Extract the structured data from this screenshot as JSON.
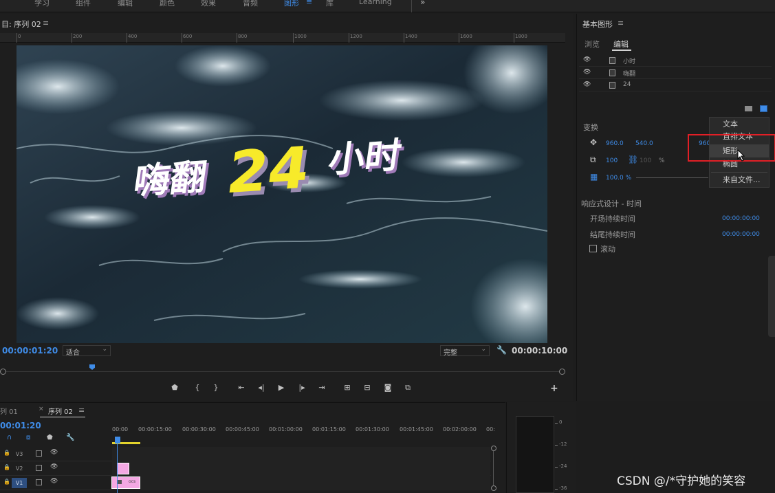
{
  "workspaces": {
    "items": [
      "学习",
      "组件",
      "编辑",
      "颜色",
      "效果",
      "音频",
      "图形",
      "库",
      "Learning"
    ],
    "active": "图形",
    "more_icon": "double-chevron-right",
    "menu_icon": "hamburger"
  },
  "program_monitor": {
    "tab_title": "目: 序列 02",
    "ruler_ticks": [
      "0",
      "200",
      "400",
      "600",
      "800",
      "1000",
      "1200",
      "1400",
      "1600",
      "1800"
    ],
    "title_text": {
      "part1": "嗨翻",
      "number": "24",
      "part2": "小时"
    },
    "timecode_current": "00:00:01:20",
    "fit_select": "适合",
    "quality_select": "完整",
    "timecode_duration": "00:00:10:00",
    "transport_buttons": [
      "marker",
      "mark-in",
      "mark-out",
      "go-to-in",
      "step-back",
      "play",
      "step-forward",
      "go-to-out",
      "insert",
      "overwrite",
      "export-frame",
      "compare"
    ],
    "add_button": "+"
  },
  "essential_graphics": {
    "title": "基本图形",
    "tabs": [
      "浏览",
      "编辑"
    ],
    "active_tab": "编辑",
    "layers": [
      {
        "name": "小时"
      },
      {
        "name": "嗨翻"
      },
      {
        "name": "24"
      }
    ],
    "transform_label": "变换",
    "position_x": "960.0",
    "position_y": "540.0",
    "anchor_x": "960",
    "scale": "100",
    "scale_pct": "%",
    "scale_link": "100",
    "opacity": "100.0 %",
    "context_menu": {
      "items": [
        "文本",
        "直排文本",
        "矩形",
        "椭圆",
        "来自文件..."
      ],
      "highlighted": "矩形"
    },
    "responsive_label": "响应式设计 - 时间",
    "intro_duration_label": "开场持续时间",
    "intro_duration_value": "00:00:00:00",
    "outro_duration_label": "结尾持续时间",
    "outro_duration_value": "00:00:00:00",
    "roll_label": "滚动",
    "accent_color": "#3f8ce8",
    "highlight_box_color": "#e21f26"
  },
  "timeline": {
    "tabs": [
      "列 01",
      "序列 02"
    ],
    "active_tab": "序列 02",
    "close_icon": "×",
    "current_time": "00:01:20",
    "ruler": [
      "00:00",
      "00:00:15:00",
      "00:00:30:00",
      "00:00:45:00",
      "00:01:00:00",
      "00:01:15:00",
      "00:01:30:00",
      "00:01:45:00",
      "00:02:00:00",
      "00:"
    ],
    "tracks": [
      {
        "name": "V3",
        "selected": false
      },
      {
        "name": "V2",
        "selected": false
      },
      {
        "name": "V1",
        "selected": true
      }
    ],
    "clip_v1_label": "ocs",
    "clip_color": "#f4a8e3",
    "work_area_color": "#e3d32c"
  },
  "audio_meter": {
    "scale": [
      "0",
      "-12",
      "-24",
      "-36"
    ]
  },
  "watermark": "CSDN @/*守护她的笑容"
}
